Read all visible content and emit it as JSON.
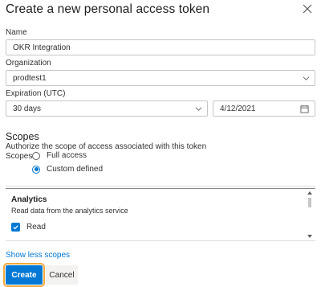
{
  "dialog": {
    "title": "Create a new personal access token"
  },
  "form": {
    "name_label": "Name",
    "name_value": "OKR Integration",
    "org_label": "Organization",
    "org_value": "prodtest1",
    "expiration_label": "Expiration (UTC)",
    "expiration_value": "30 days",
    "date_value": "4/12/2021"
  },
  "scopes": {
    "heading": "Scopes",
    "description": "Authorize the scope of access associated with this token",
    "radio_label": "Scopes",
    "options": [
      "Full access",
      "Custom defined"
    ],
    "selected": "Custom defined",
    "section_title": "Analytics",
    "section_desc": "Read data from the analytics service",
    "permission_label": "Read",
    "permission_checked": true
  },
  "footer": {
    "toggle_link": "Show less scopes",
    "create_label": "Create",
    "cancel_label": "Cancel"
  },
  "colors": {
    "accent": "#0078d4",
    "focus_outline": "#f2a93b"
  }
}
